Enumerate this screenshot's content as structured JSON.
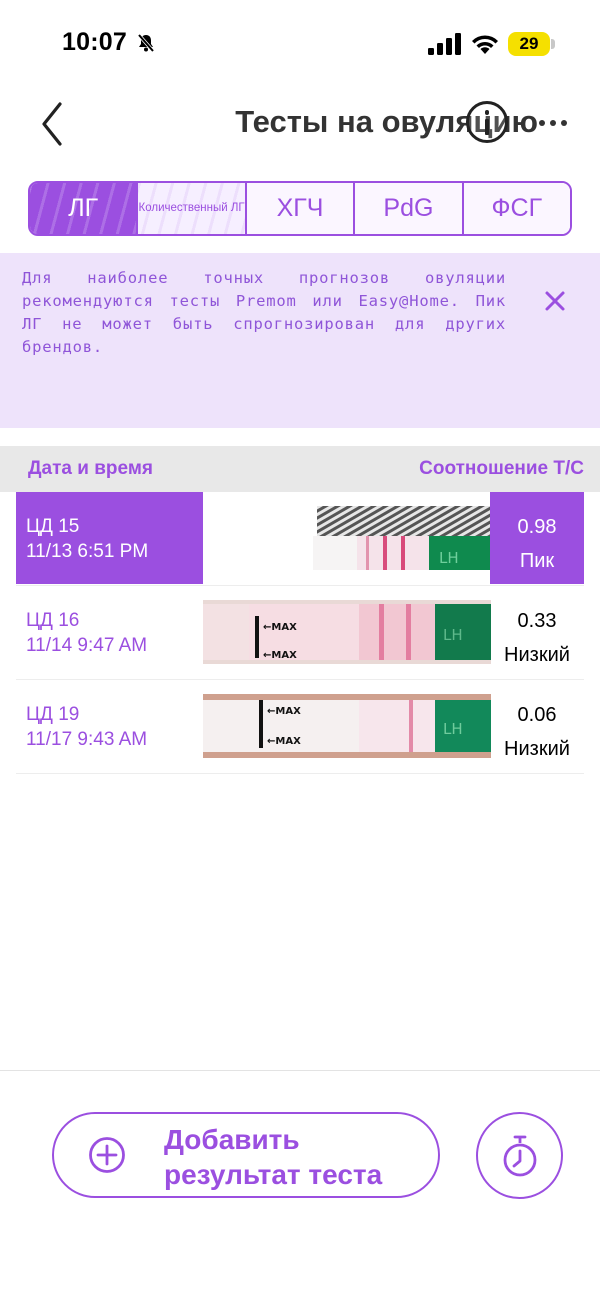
{
  "status_bar": {
    "time": "10:07",
    "battery_level": "29",
    "icons": [
      "bell-slash-icon",
      "signal-icon",
      "wifi-icon",
      "battery-icon"
    ]
  },
  "nav": {
    "title": "Тесты на овуляцию",
    "back_icon": "chevron-left-icon",
    "info_icon": "info-icon",
    "more_icon": "more-icon"
  },
  "tabs": [
    {
      "label": "ЛГ",
      "active": true
    },
    {
      "label": "Количественный ЛГ",
      "active": false
    },
    {
      "label": "ХГЧ",
      "active": false
    },
    {
      "label": "PdG",
      "active": false
    },
    {
      "label": "ФСГ",
      "active": false
    }
  ],
  "notice": {
    "text": "Для наиболее точных прогнозов овуляции рекомендуются тесты Premom или Easy@Home. Пик ЛГ не может быть спрогнозирован для других брендов.",
    "close_icon": "close-icon"
  },
  "table": {
    "header_left": "Дата и время",
    "header_right": "Соотношение T/C",
    "rows": [
      {
        "cycle_day": "ЦД 15",
        "datetime": "11/13 6:51 PM",
        "ratio": "0.98",
        "level": "Пик",
        "strip_text": ""
      },
      {
        "cycle_day": "ЦД 16",
        "datetime": "11/14 9:47 AM",
        "ratio": "0.33",
        "level": "Низкий",
        "strip_text": "MAX"
      },
      {
        "cycle_day": "ЦД 19",
        "datetime": "11/17 9:43 AM",
        "ratio": "0.06",
        "level": "Низкий",
        "strip_text": "MAX"
      }
    ]
  },
  "actions": {
    "add_label": "Добавить результат теста",
    "add_icon": "plus-circle-icon",
    "timer_icon": "stopwatch-icon"
  },
  "colors": {
    "accent": "#9b4fe0",
    "notice_bg": "#eee3fb",
    "header_bg": "#e8e8e8",
    "battery": "#f5e000",
    "strip_green": "#0f8a4e"
  }
}
